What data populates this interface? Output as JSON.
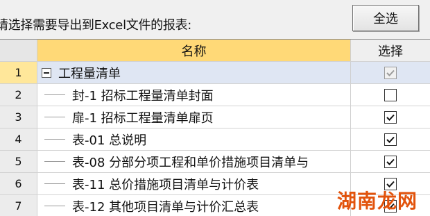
{
  "toolbar": {
    "prompt": "请选择需要导出到Excel文件的报表:",
    "select_all_label": "全选"
  },
  "table": {
    "headers": {
      "num": "",
      "name": "名称",
      "select": "选择"
    },
    "rows": [
      {
        "num": "1",
        "name": "工程量清单",
        "checked": true,
        "group": true
      },
      {
        "num": "2",
        "name": "封-1 招标工程量清单封面",
        "checked": false
      },
      {
        "num": "3",
        "name": "扉-1 招标工程量清单扉页",
        "checked": true
      },
      {
        "num": "4",
        "name": "表-01 总说明",
        "checked": true
      },
      {
        "num": "5",
        "name": "表-08 分部分项工程和单价措施项目清单与",
        "checked": true
      },
      {
        "num": "6",
        "name": "表-11 总价措施项目清单与计价表",
        "checked": true
      },
      {
        "num": "7",
        "name": "表-12 其他项目清单与计价汇总表",
        "checked": true
      }
    ]
  },
  "watermark": "湖南龙网",
  "colors": {
    "header_name_bg": "#ffd977",
    "group_row_bg": "#dfe6f3",
    "watermark": "#e2530c"
  }
}
